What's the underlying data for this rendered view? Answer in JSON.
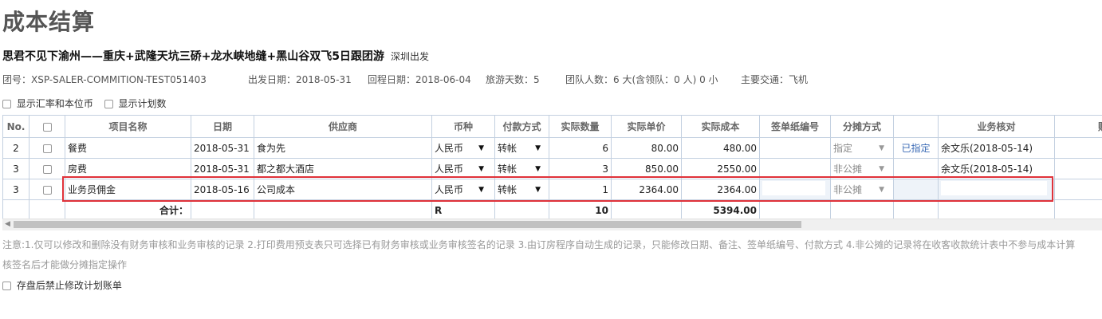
{
  "page": {
    "title": "成本结算",
    "tour_name": "思君不见下渝州——重庆+武隆天坑三硚+龙水峡地缝+黑山谷双飞5日跟团游",
    "departure": "深圳出发"
  },
  "info": {
    "group_no": "团号：XSP-SALER-COMMITION-TEST051403",
    "depart_date": "出发日期：2018-05-31",
    "return_date": "回程日期：2018-06-04",
    "days": "旅游天数：5",
    "people": "团队人数：6 大(含领队：0 人) 0 小",
    "transport": "主要交通：飞机"
  },
  "options": {
    "show_rate": "显示汇率和本位币",
    "show_plan": "显示计划数"
  },
  "table": {
    "headers": [
      "No.",
      "",
      "项目名称",
      "日期",
      "供应商",
      "币种",
      "付款方式",
      "实际数量",
      "实际单价",
      "实际成本",
      "签单纸编号",
      "分摊方式",
      "",
      "业务核对",
      "财"
    ],
    "rows": [
      {
        "no": "2",
        "item": "餐费",
        "date": "2018-05-31",
        "supplier": "食为先",
        "currency": "人民币",
        "pay": "转帐",
        "qty": "6",
        "price": "80.00",
        "cost": "480.00",
        "sign_no": "",
        "share": "指定",
        "share_link": "已指定",
        "check": "余文乐(2018-05-14)"
      },
      {
        "no": "3",
        "item": "房费",
        "date": "2018-05-31",
        "supplier": "都之都大酒店",
        "currency": "人民币",
        "pay": "转帐",
        "qty": "3",
        "price": "850.00",
        "cost": "2550.00",
        "sign_no": "",
        "share": "非公摊",
        "share_link": "",
        "check": "余文乐(2018-05-14)"
      },
      {
        "no": "3",
        "item": "业务员佣金",
        "date": "2018-05-16",
        "supplier": "公司成本",
        "currency": "人民币",
        "pay": "转帐",
        "qty": "1",
        "price": "2364.00",
        "cost": "2364.00",
        "sign_no": "",
        "share": "非公摊",
        "share_link": "",
        "check": ""
      }
    ],
    "total": {
      "label": "合计：",
      "currency": "R",
      "qty": "10",
      "cost": "5394.00"
    }
  },
  "notes": {
    "line1": "注意:1.仅可以修改和删除没有财务审核和业务审核的记录    2.打印费用预支表只可选择已有财务审核或业务审核签名的记录    3.由订房程序自动生成的记录，只能修改日期、备注、签单纸编号、付款方式    4.非公摊的记录将在收客收款统计表中不参与成本计算",
    "line2": "核签名后才能做分摊指定操作"
  },
  "footer": {
    "lock_label": "存盘后禁止修改计划账单"
  },
  "colors": {
    "highlight_border": "#e0323a",
    "grid_border": "#c3d0e0",
    "link": "#3a6ab5"
  }
}
